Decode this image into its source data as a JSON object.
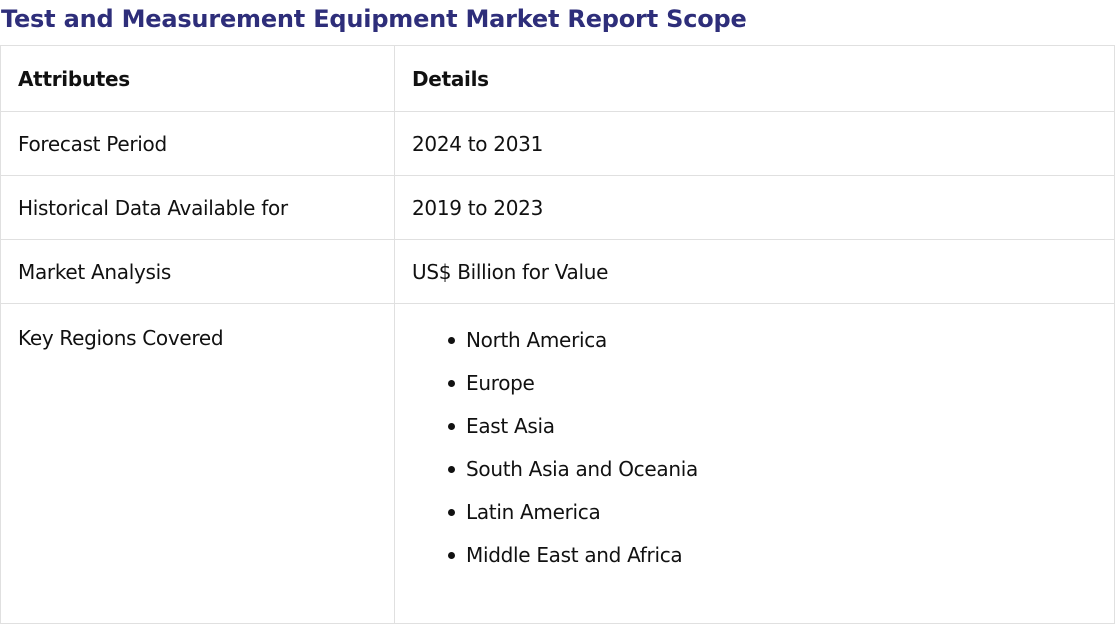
{
  "title": "Test and Measurement Equipment Market Report Scope",
  "table": {
    "headers": [
      "Attributes",
      "Details"
    ],
    "rows": [
      {
        "attribute": "Forecast Period",
        "detail": "2024 to 2031"
      },
      {
        "attribute": "Historical Data Available for",
        "detail": "2019 to 2023"
      },
      {
        "attribute": "Market Analysis",
        "detail": "US$ Billion for Value"
      }
    ],
    "regions": {
      "attribute": "Key Regions Covered",
      "items": [
        "North America",
        "Europe",
        "East Asia",
        "South Asia and Oceania",
        "Latin America",
        "Middle East and Africa"
      ]
    }
  },
  "colors": {
    "title": "#2e2e7a",
    "border": "#e0e0e0",
    "text": "#111111"
  }
}
